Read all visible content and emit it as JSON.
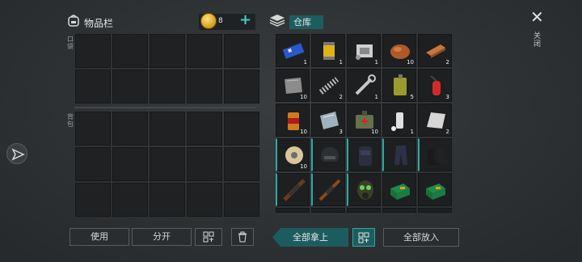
{
  "inventory": {
    "title": "物品栏",
    "coins": "8",
    "add_icon": "plus-icon",
    "pocket_label": "口袋",
    "backpack_label": "背包",
    "buttons": {
      "use": "使用",
      "split": "分开"
    }
  },
  "warehouse": {
    "title": "仓库",
    "close_label": "关闭",
    "take_all": "全部拿上",
    "put_all": "全部放入",
    "items": [
      {
        "name": "circuit-board",
        "count": "1"
      },
      {
        "name": "fuel-filter",
        "count": "1"
      },
      {
        "name": "engine-part",
        "count": "1"
      },
      {
        "name": "copper-ore",
        "count": "10"
      },
      {
        "name": "copper-ingot",
        "count": "2"
      },
      {
        "name": "metal-plate",
        "count": "10"
      },
      {
        "name": "spring",
        "count": "2"
      },
      {
        "name": "wrench",
        "count": "1"
      },
      {
        "name": "jerry-can",
        "count": "5"
      },
      {
        "name": "fire-extinguisher",
        "count": "3"
      },
      {
        "name": "tin-can",
        "count": "10"
      },
      {
        "name": "glass-sheet",
        "count": "3"
      },
      {
        "name": "first-aid-bag",
        "count": "10"
      },
      {
        "name": "spray-can",
        "count": "1"
      },
      {
        "name": "steel-sheet",
        "count": "2"
      },
      {
        "name": "wire-spool",
        "count": "10"
      },
      {
        "name": "tactical-helmet",
        "count": ""
      },
      {
        "name": "tactical-vest",
        "count": ""
      },
      {
        "name": "combat-pants",
        "count": ""
      },
      {
        "name": "combat-boots",
        "count": ""
      },
      {
        "name": "assault-rifle",
        "count": ""
      },
      {
        "name": "shotgun",
        "count": ""
      },
      {
        "name": "gas-mask",
        "count": ""
      },
      {
        "name": "toolbox-green",
        "count": ""
      },
      {
        "name": "toolbox-green-2",
        "count": ""
      }
    ]
  },
  "colors": {
    "accent": "#2da9a0",
    "coin": "#d49a18"
  }
}
